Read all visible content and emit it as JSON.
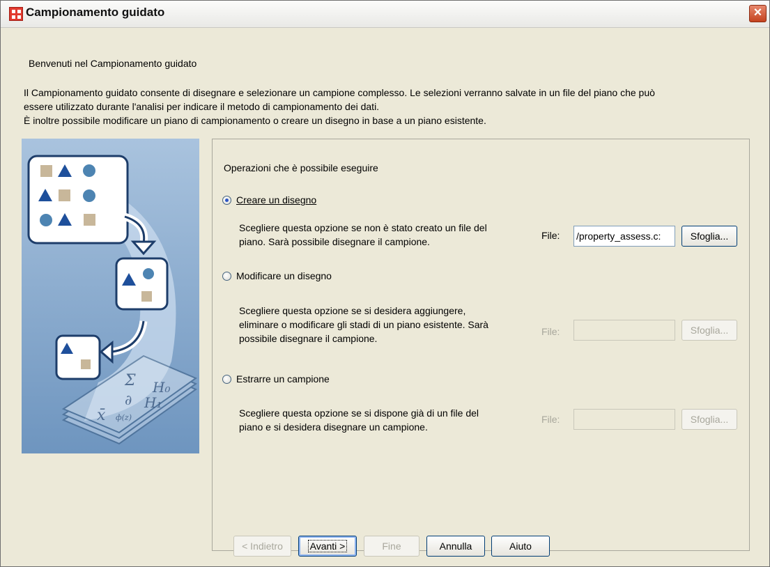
{
  "window": {
    "title": "Campionamento guidato"
  },
  "welcome": "Benvenuti nel Campionamento guidato",
  "intro": [
    "Il Campionamento guidato consente di disegnare e selezionare un campione complesso. Le selezioni verranno salvate in un file del piano che può",
    "essere utilizzato durante l'analisi per indicare il metodo di campionamento dei dati.",
    "È inoltre possibile modificare un piano di campionamento o creare un disegno in base a un piano esistente."
  ],
  "illustration": {
    "symbols": [
      "Σ",
      "H₀",
      "∂",
      "H₁",
      "x̄",
      "ф(z)"
    ]
  },
  "panel": {
    "heading": "Operazioni che è possibile eseguire",
    "options": [
      {
        "label": "Creare un disegno",
        "selected": true,
        "desc": [
          "Scegliere questa opzione se non è stato creato un file del",
          "piano. Sarà possibile disegnare il campione."
        ],
        "file_label": "File:",
        "file_value": "/property_assess.c:",
        "browse": "Sfoglia..."
      },
      {
        "label": "Modificare un disegno",
        "selected": false,
        "desc": [
          "Scegliere questa opzione se si desidera aggiungere,",
          "eliminare o modificare gli stadi di un piano esistente. Sarà",
          "possibile disegnare il campione."
        ],
        "file_label": "File:",
        "file_value": "",
        "browse": "Sfoglia..."
      },
      {
        "label": "Estrarre un campione",
        "selected": false,
        "desc": [
          "Scegliere questa opzione se si dispone già di un file del",
          "piano e si desidera disegnare un campione."
        ],
        "file_label": "File:",
        "file_value": "",
        "browse": "Sfoglia..."
      }
    ]
  },
  "buttons": {
    "back": "< Indietro",
    "next": "Avanti >",
    "finish": "Fine",
    "cancel": "Annulla",
    "help": "Aiuto"
  },
  "colors": {
    "accent": "#2c55c4",
    "illustration_bg": "#7fa3c9"
  }
}
